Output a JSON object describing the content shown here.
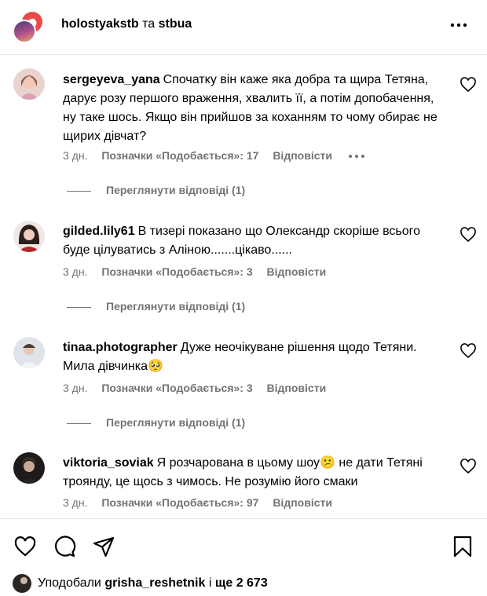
{
  "header": {
    "account_primary": "holostyakstb",
    "joiner": "та",
    "account_secondary": "stbua",
    "more_icon": "more-horizontal-icon"
  },
  "comments": [
    {
      "username": "sergeyeva_yana",
      "text": "Спочатку він каже яка добра та щира Тетяна, дарує розу першого враження, хвалить її, а потім допобачення, ну таке шось. Якщо він прийшов за коханням то чому обирає не щирих дівчат?",
      "time": "3 дн.",
      "likes": "Позначки «Подобається»: 17",
      "reply": "Відповісти",
      "view_replies": "Переглянути відповіді (1)",
      "avatar_color": "#d9a0b0"
    },
    {
      "username": "gilded.lily61",
      "text": "В тизері показано що Олександр скоріше всього буде цілуватись з Аліною.......цікаво......",
      "time": "3 дн.",
      "likes": "Позначки «Подобається»: 3",
      "reply": "Відповісти",
      "view_replies": "Переглянути відповіді (1)",
      "avatar_color": "#2a1e1e"
    },
    {
      "username": "tinaa.photographer",
      "text": "Дуже неочікуване рішення щодо Тетяни. Мила дівчинка🥺",
      "time": "3 дн.",
      "likes": "Позначки «Подобається»: 3",
      "reply": "Відповісти",
      "view_replies": "Переглянути відповіді (1)",
      "avatar_color": "#c8ccd6"
    },
    {
      "username": "viktoria_soviak",
      "text": "Я розчарована в цьому шоу😕 не дати Тетяні троянду, це щось з чимось. Не розумію його смаки",
      "time": "3 дн.",
      "likes": "Позначки «Подобається»: 97",
      "reply": "Відповісти",
      "avatar_color": "#1e1a1a"
    }
  ],
  "footer": {
    "icons": [
      "heart-icon",
      "comment-icon",
      "share-icon",
      "bookmark-icon"
    ],
    "liked_by_prefix": "Уподобали",
    "liked_by_user": "grisha_reshetnik",
    "liked_by_joiner": "і",
    "liked_by_count": "ще 2 673"
  }
}
